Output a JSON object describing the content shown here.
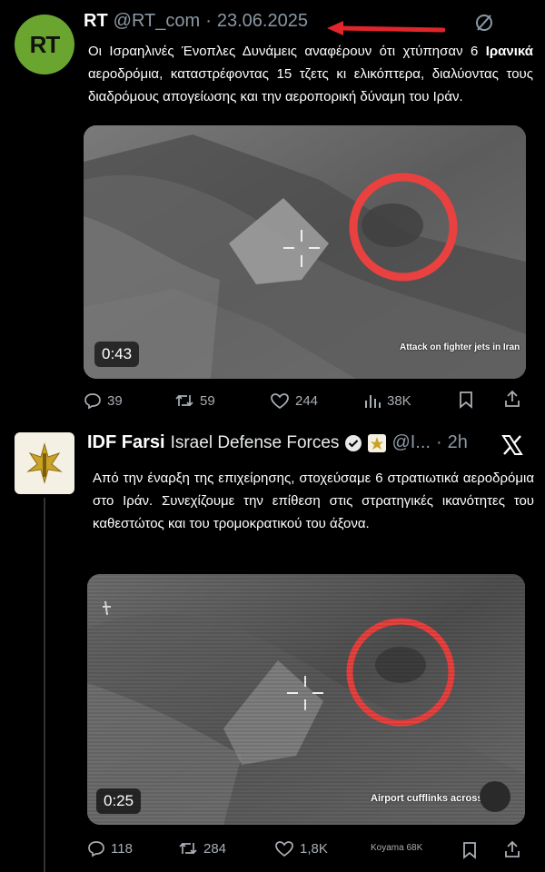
{
  "post1": {
    "author": "RT",
    "handle": "@RT_com",
    "separator": "·",
    "date": "23.06.2025",
    "avatar_text": "RT",
    "text_part1": "Οι Ισραηλινές Ένοπλες Δυνάμεις αναφέρουν ότι χτύπησαν 6 ",
    "text_bold": "Ιρανικά",
    "text_part2": " αεροδρόμια, καταστρέφοντας 15 τζετς κι ελικόπτερα, διαλύοντας τους διαδρόμους απογείωσης και την αεροπορική δύναμη του Ιράν.",
    "video": {
      "duration": "0:43",
      "caption": "Attack on fighter jets in Iran"
    },
    "stats": {
      "replies": "39",
      "reposts": "59",
      "likes": "244",
      "views": "38K"
    }
  },
  "post2": {
    "author": "IDF Farsi",
    "affiliation": "Israel Defense Forces",
    "handle": "@I...",
    "separator": "·",
    "time": "2h",
    "text": "Από την έναρξη της επιχείρησης, στοχεύσαμε 6 στρατιωτικά αεροδρόμια στο Ιράν. Συνεχίζουμε την επίθεση στις στρατηγικές ικανότητες του καθεστώτος και του τρομοκρατικού του άξονα.",
    "video": {
      "duration": "0:25",
      "caption": "Airport cufflinks across Iran"
    },
    "stats": {
      "replies": "118",
      "reposts": "284",
      "likes": "1,8K",
      "watermark": "Koyama 68K"
    }
  },
  "colors": {
    "rt_green": "#6aa62f",
    "arrow_red": "#e0262b",
    "circle_red": "#e9413f",
    "muted": "#8b98a5",
    "verified_blue": "#1d9bf0"
  },
  "icons": [
    "grok-slash-icon",
    "reply-icon",
    "repost-icon",
    "like-icon",
    "views-icon",
    "bookmark-icon",
    "share-icon",
    "verified-badge-icon",
    "x-logo-icon",
    "idf-emblem-icon"
  ]
}
